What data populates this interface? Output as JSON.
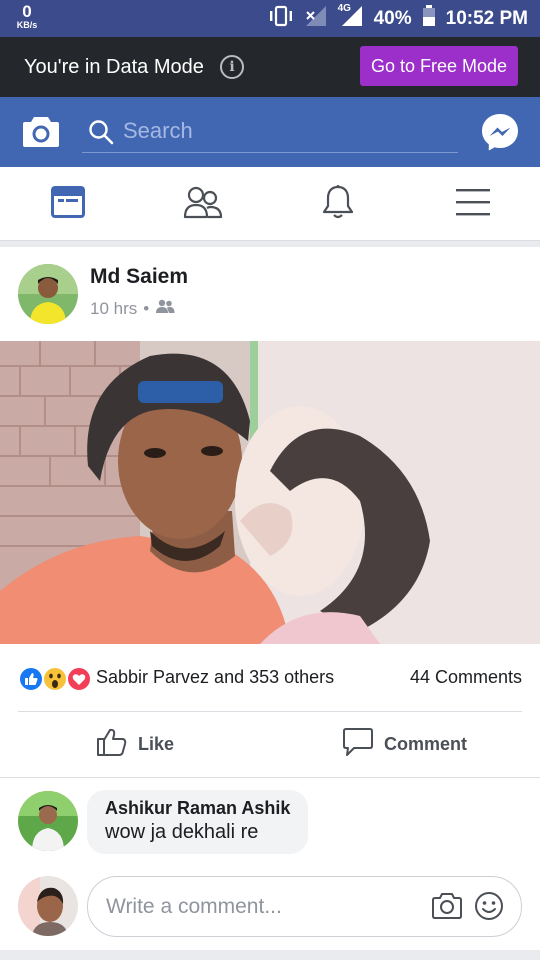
{
  "status_bar": {
    "speed_value": "0",
    "speed_unit": "KB/s",
    "network": "4G",
    "battery": "40%",
    "time": "10:52 PM"
  },
  "data_mode_bar": {
    "message": "You're in Data Mode",
    "info_glyph": "i",
    "free_mode_button": "Go to Free Mode"
  },
  "header": {
    "search_placeholder": "Search",
    "icons": [
      "camera-icon",
      "search-icon",
      "messenger-icon"
    ]
  },
  "nav_tabs": [
    {
      "name": "news-feed",
      "icon": "news-feed-icon",
      "active": true
    },
    {
      "name": "friends",
      "icon": "friends-icon",
      "active": false
    },
    {
      "name": "notifications",
      "icon": "bell-icon",
      "active": false
    },
    {
      "name": "menu",
      "icon": "menu-icon",
      "active": false
    }
  ],
  "post": {
    "author": "Md Saiem",
    "time": "10 hrs",
    "separator": "•",
    "privacy_icon": "friends-icon",
    "reactions_text": "Sabbir Parvez and 353 others",
    "reaction_icons": [
      "like-icon",
      "wow-icon",
      "love-icon"
    ],
    "comments_count": "44 Comments",
    "actions": {
      "like": "Like",
      "comment": "Comment"
    }
  },
  "comments": [
    {
      "author": "Ashikur Raman Ashik",
      "text": "wow ja dekhali re"
    }
  ],
  "composer": {
    "placeholder": "Write a comment..."
  },
  "colors": {
    "status_bar": "#3b4b8c",
    "data_bar": "#24272b",
    "free_mode_button": "#9c2ec9",
    "header": "#4267b2",
    "active_tab": "#4267b2"
  }
}
